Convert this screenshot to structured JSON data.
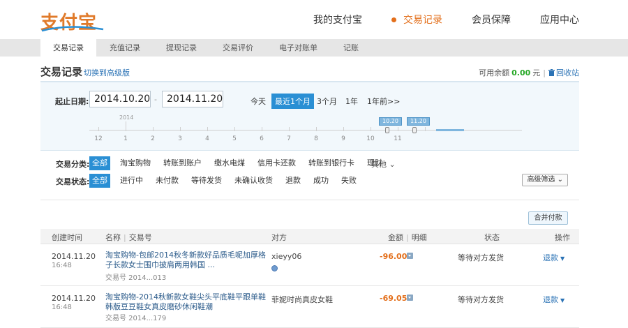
{
  "brand": {
    "logo_text": "支付宝",
    "accent": "#e36f1b",
    "blue": "#2a8fd4"
  },
  "main_nav": [
    {
      "label": "我的支付宝",
      "active": false
    },
    {
      "label": "交易记录",
      "active": true
    },
    {
      "label": "会员保障",
      "active": false
    },
    {
      "label": "应用中心",
      "active": false
    }
  ],
  "sub_nav": [
    {
      "label": "交易记录",
      "active": true
    },
    {
      "label": "充值记录"
    },
    {
      "label": "提现记录"
    },
    {
      "label": "交易评价"
    },
    {
      "label": "电子对账单"
    },
    {
      "label": "记账"
    }
  ],
  "title": {
    "text": "交易记录",
    "switch_link": "切换到高级版",
    "balance_label": "可用余额",
    "balance_amount": "0.00",
    "balance_unit": "元",
    "recycle": "回收站",
    "recycle_icon": "trash-icon"
  },
  "date_filter": {
    "label": "起止日期:",
    "from": "2014.10.20",
    "dash": "-",
    "to": "2014.11.20",
    "quick": [
      {
        "label": "今天",
        "active": false
      },
      {
        "label": "最近1个月",
        "active": true
      },
      {
        "label": "3个月",
        "active": false
      },
      {
        "label": "1年",
        "active": false
      },
      {
        "label": "1年前>>",
        "active": false
      }
    ],
    "timeline": {
      "year": "2014",
      "months": [
        "12",
        "1",
        "2",
        "3",
        "4",
        "5",
        "6",
        "7",
        "8",
        "9",
        "10",
        "11"
      ],
      "flag_from": "10.20",
      "flag_to": "11.20"
    }
  },
  "category_filter": {
    "label": "交易分类:",
    "options": [
      "全部",
      "淘宝购物",
      "转账到账户",
      "缴水电煤",
      "信用卡还款",
      "转账到银行卡",
      "理财"
    ],
    "active_index": 0,
    "more": "其他 ⌄"
  },
  "status_filter": {
    "label": "交易状态:",
    "options": [
      "全部",
      "进行中",
      "未付款",
      "等待发货",
      "未确认收货",
      "退款",
      "成功",
      "失败"
    ],
    "active_index": 0,
    "advanced": "高级筛选 ⌄"
  },
  "merge_pay": "合并付款",
  "table": {
    "headers": {
      "created": "创建时间",
      "name": "名称",
      "txn_no": "交易号",
      "party": "对方",
      "amount": "金额",
      "detail": "明细",
      "status": "状态",
      "op": "操作"
    },
    "rows": [
      {
        "date": "2014.11.20",
        "time": "16:48",
        "name": "淘宝购物-包邮2014秋冬新款好品质毛呢加厚格子长款女士围巾披肩两用韩国 ...",
        "txn": "交易号 2014...013",
        "party": "xieyy06",
        "amount": "-96.00",
        "status": "等待对方发货",
        "op": "退款"
      },
      {
        "date": "2014.11.20",
        "time": "16:48",
        "name": "淘宝购物-2014秋新款女鞋尖头平底鞋平跟单鞋韩版豆豆鞋女真皮磨砂休闲鞋潮",
        "txn": "交易号 2014...179",
        "party": "菲妮时尚真皮女鞋",
        "amount": "-69.05",
        "status": "等待对方发货",
        "op": "退款"
      }
    ]
  }
}
